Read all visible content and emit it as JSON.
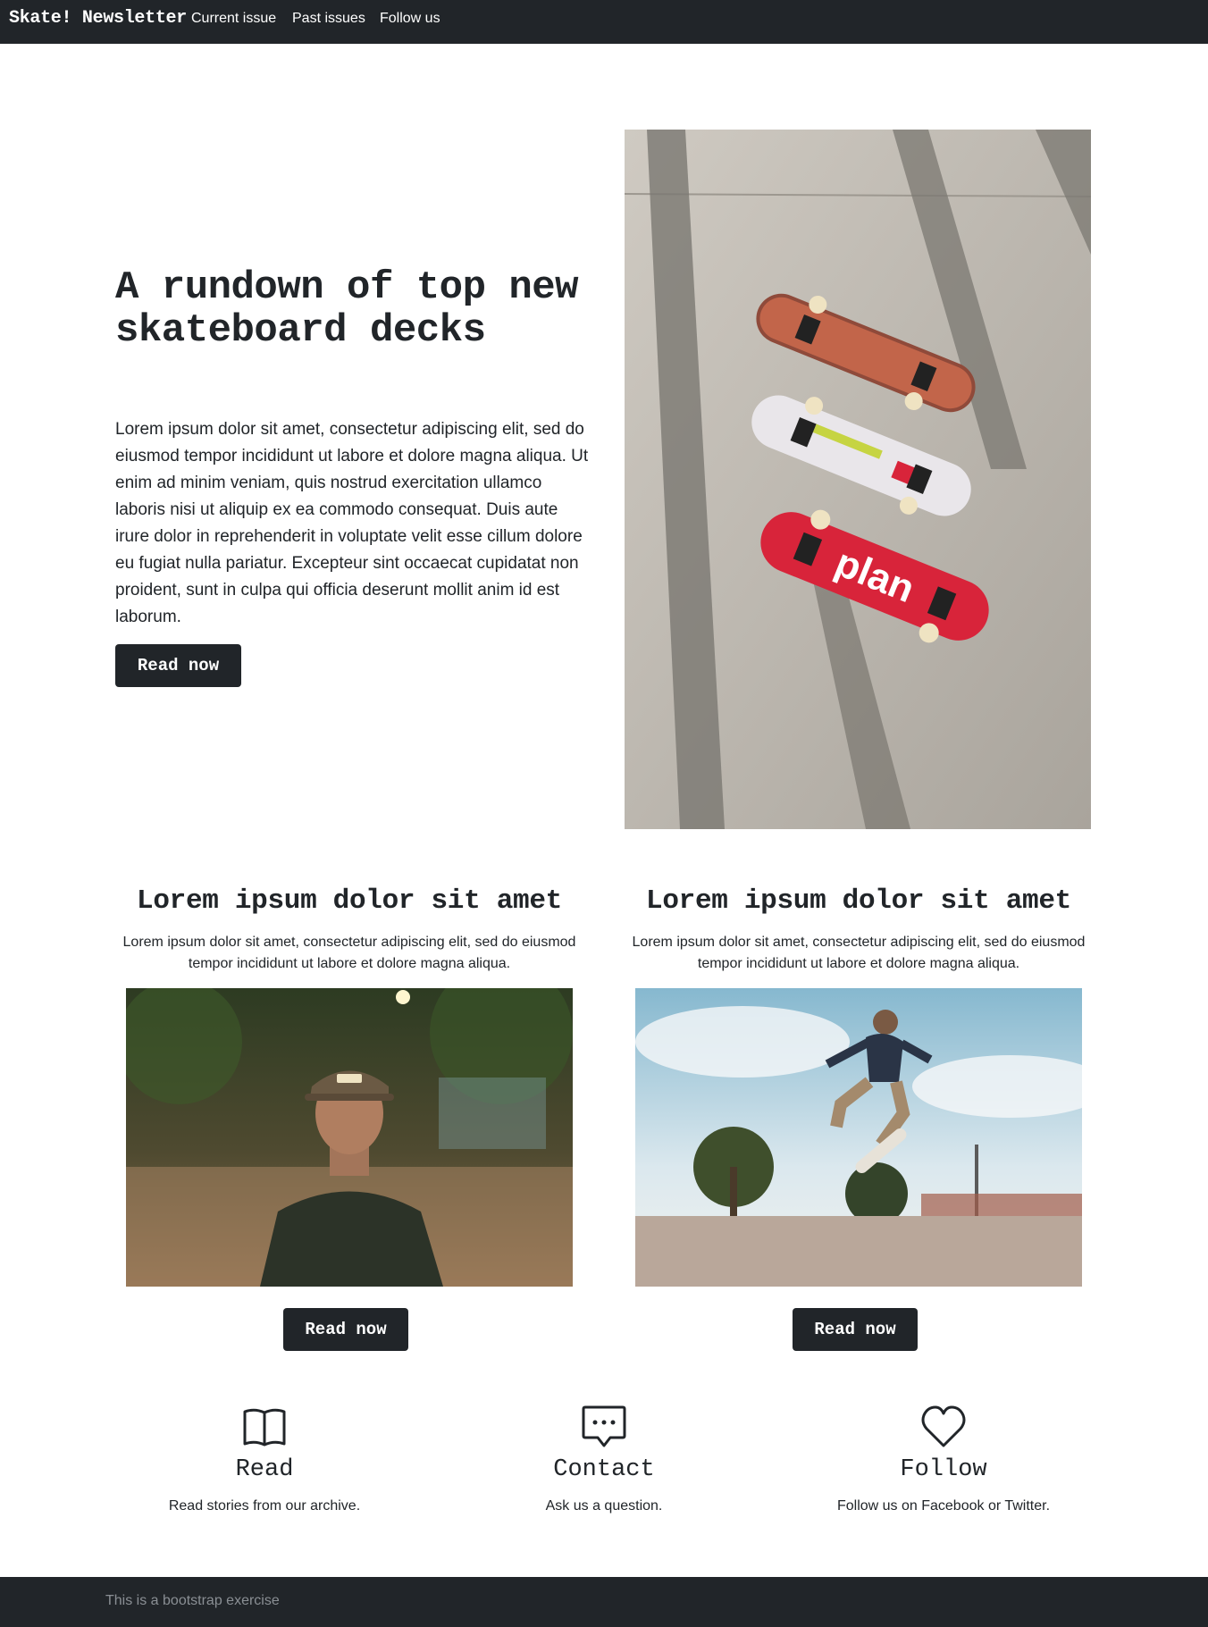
{
  "navbar": {
    "brand": "Skate! Newsletter",
    "links": [
      "Current issue",
      "Past issues",
      "Follow us"
    ]
  },
  "hero": {
    "title": "A rundown of top new skateboard decks",
    "text": "Lorem ipsum dolor sit amet, consectetur adipiscing elit, sed do eiusmod tempor incididunt ut labore et dolore magna aliqua. Ut enim ad minim veniam, quis nostrud exercitation ullamco laboris nisi ut aliquip ex ea commodo consequat. Duis aute irure dolor in reprehenderit in voluptate velit esse cillum dolore eu fugiat nulla pariatur. Excepteur sint occaecat cupidatat non proident, sunt in culpa qui officia deserunt mollit anim id est laborum.",
    "button": "Read now",
    "image_deck_text": "plan"
  },
  "cards": [
    {
      "title": "Lorem ipsum dolor sit amet",
      "text": "Lorem ipsum dolor sit amet, consectetur adipiscing elit, sed do eiusmod tempor incididunt ut labore et dolore magna aliqua.",
      "button": "Read now"
    },
    {
      "title": "Lorem ipsum dolor sit amet",
      "text": "Lorem ipsum dolor sit amet, consectetur adipiscing elit, sed do eiusmod tempor incididunt ut labore et dolore magna aliqua.",
      "button": "Read now"
    }
  ],
  "features": [
    {
      "icon": "book-icon",
      "title": "Read",
      "text": "Read stories from our archive."
    },
    {
      "icon": "chat-icon",
      "title": "Contact",
      "text": "Ask us a question."
    },
    {
      "icon": "heart-icon",
      "title": "Follow",
      "text": "Follow us on Facebook or Twitter."
    }
  ],
  "footer": {
    "text": "This is a bootstrap exercise"
  },
  "colors": {
    "dark": "#212529",
    "footer_text": "#8a8f94",
    "deck_red": "#d8243a"
  }
}
